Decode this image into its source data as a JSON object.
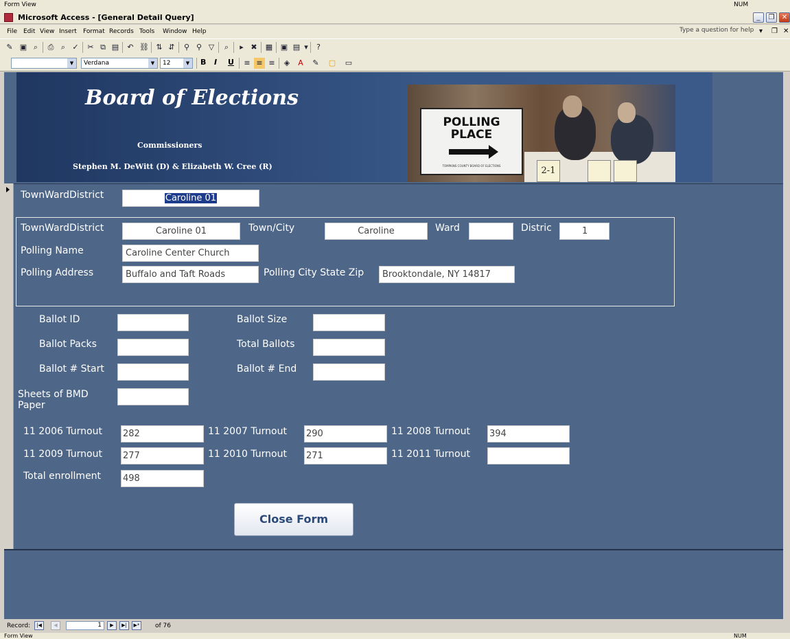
{
  "status_top": {
    "mode": "Form View",
    "num": "NUM"
  },
  "window": {
    "title": "Microsoft Access - [General Detail Query]"
  },
  "menu": {
    "items": [
      "File",
      "Edit",
      "View",
      "Insert",
      "Format",
      "Records",
      "Tools",
      "Window",
      "Help"
    ],
    "help_placeholder": "Type a question for help"
  },
  "formatting": {
    "control": "",
    "font": "Verdana",
    "size": "12"
  },
  "header": {
    "title": "Board of Elections",
    "commissioners_label": "Commissioners",
    "commissioners_names": "Stephen M. DeWitt (D) & Elizabeth W. Cree (R)",
    "sign_text": "POLLING PLACE",
    "sign_small": "TOMPKINS COUNTY BOARD OF ELECTIONS",
    "table_card": "2-1"
  },
  "form": {
    "twd_label": "TownWardDistrict",
    "twd_value": "Caroline 01",
    "detail": {
      "twd_label": "TownWardDistrict",
      "twd_value": "Caroline 01",
      "town_label": "Town/City",
      "town_value": "Caroline",
      "ward_label": "Ward",
      "ward_value": "",
      "district_label": "Distric",
      "district_value": "1",
      "polling_name_label": "Polling Name",
      "polling_name_value": "Caroline Center Church",
      "polling_address_label": "Polling Address",
      "polling_address_value": "Buffalo and Taft Roads",
      "polling_csz_label": "Polling City State Zip",
      "polling_csz_value": "Brooktondale, NY 14817"
    },
    "ballots": {
      "ballot_id_label": "Ballot ID",
      "ballot_id_value": "",
      "ballot_size_label": "Ballot Size",
      "ballot_size_value": "",
      "ballot_packs_label": "Ballot Packs",
      "ballot_packs_value": "",
      "total_ballots_label": "Total Ballots",
      "total_ballots_value": "",
      "ballot_start_label": "Ballot # Start",
      "ballot_start_value": "",
      "ballot_end_label": "Ballot # End",
      "ballot_end_value": "",
      "bmd_label_1": "Sheets of BMD",
      "bmd_label_2": "Paper",
      "bmd_value": ""
    },
    "turnout": {
      "t2006_label": "11 2006 Turnout",
      "t2006_value": "282",
      "t2007_label": "11 2007 Turnout",
      "t2007_value": "290",
      "t2008_label": "11 2008 Turnout",
      "t2008_value": "394",
      "t2009_label": "11 2009 Turnout",
      "t2009_value": "277",
      "t2010_label": "11 2010 Turnout",
      "t2010_value": "271",
      "t2011_label": "11 2011 Turnout",
      "t2011_value": "",
      "enroll_label": "Total enrollment",
      "enroll_value": "498"
    },
    "close_button": "Close Form"
  },
  "navigation": {
    "label": "Record:",
    "current": "1",
    "of_text": "of 76"
  },
  "status_bottom": {
    "mode": "Form View",
    "num": "NUM"
  },
  "colors": {
    "form_background": "#4e6687",
    "banner": "#2e4a78",
    "button_text": "#2b4a7a"
  }
}
